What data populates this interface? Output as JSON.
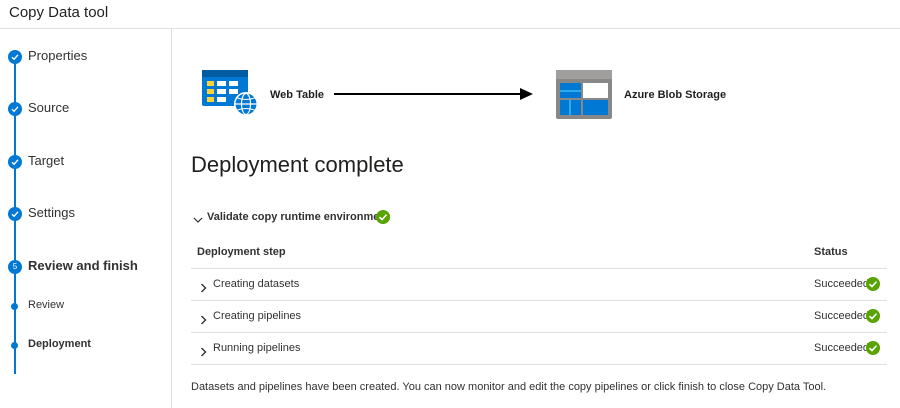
{
  "app": {
    "title": "Copy Data tool"
  },
  "steps": [
    {
      "label": "Properties",
      "state": "done"
    },
    {
      "label": "Source",
      "state": "done"
    },
    {
      "label": "Target",
      "state": "done"
    },
    {
      "label": "Settings",
      "state": "done"
    },
    {
      "label": "Review and finish",
      "state": "current",
      "number": "5"
    }
  ],
  "substeps": [
    {
      "label": "Review",
      "state": "inactive"
    },
    {
      "label": "Deployment",
      "state": "active"
    }
  ],
  "flow": {
    "source": {
      "label": "Web Table",
      "icon": "web-table-icon"
    },
    "target": {
      "label": "Azure Blob Storage",
      "icon": "azure-blob-storage-icon"
    }
  },
  "main": {
    "heading": "Deployment complete",
    "validate_label": "Validate copy runtime environment",
    "table": {
      "headers": [
        "Deployment step",
        "Status"
      ],
      "rows": [
        {
          "step": "Creating datasets",
          "status": "Succeeded"
        },
        {
          "step": "Creating pipelines",
          "status": "Succeeded"
        },
        {
          "step": "Running pipelines",
          "status": "Succeeded"
        }
      ]
    },
    "footer": "Datasets and pipelines have been created. You can now monitor and edit the copy pipelines or click finish to close Copy Data Tool."
  },
  "colors": {
    "accent": "#0078d4",
    "success": "#57a300",
    "border": "#e1dfdd"
  }
}
